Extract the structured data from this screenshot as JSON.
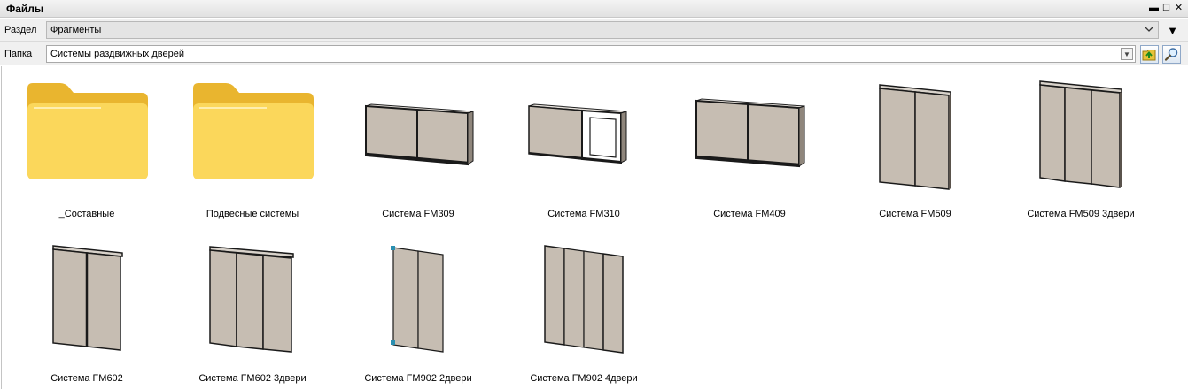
{
  "window": {
    "title": "Файлы"
  },
  "section": {
    "label": "Раздел",
    "value": "Фрагменты"
  },
  "folder": {
    "label": "Папка",
    "value": "Системы раздвижных дверей"
  },
  "items": [
    {
      "name": "_Составные",
      "icon": "folder-icon"
    },
    {
      "name": "Подвесные системы",
      "icon": "folder-icon"
    },
    {
      "name": "Система FM309",
      "icon": "wardrobe-preview"
    },
    {
      "name": "Система FM310",
      "icon": "wardrobe-preview"
    },
    {
      "name": "Система FM409",
      "icon": "wardrobe-preview"
    },
    {
      "name": "Система FM509",
      "icon": "door-preview"
    },
    {
      "name": "Система FM509 3двери",
      "icon": "door-preview"
    },
    {
      "name": "Система FM602",
      "icon": "door-preview"
    },
    {
      "name": "Система FM602 3двери",
      "icon": "door-preview"
    },
    {
      "name": "Система FM902 2двери",
      "icon": "door-preview"
    },
    {
      "name": "Система FM902 4двери",
      "icon": "door-preview"
    }
  ],
  "colors": {
    "panel": "#c6bdb2",
    "folder": "#f7c948",
    "frame": "#1a1a1a"
  }
}
